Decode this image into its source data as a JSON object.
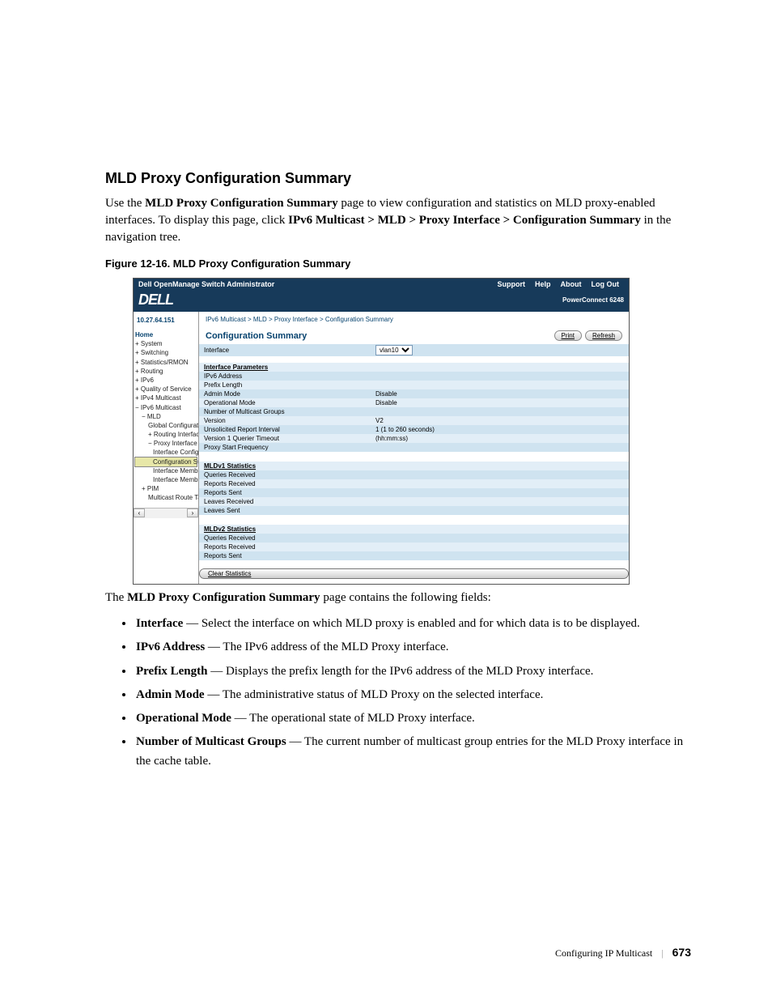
{
  "section_heading": "MLD Proxy Configuration Summary",
  "intro": {
    "pre": "Use the ",
    "bold1": "MLD Proxy Configuration Summary",
    "mid": " page to view configuration and statistics on MLD proxy-enabled interfaces. To display this page, click ",
    "bold2": "IPv6 Multicast > MLD > Proxy Interface > Configuration Summary",
    "post": " in the navigation tree."
  },
  "figure_caption": "Figure 12-16.    MLD Proxy Configuration Summary",
  "app": {
    "title": "Dell OpenManage Switch Administrator",
    "links": [
      "Support",
      "Help",
      "About",
      "Log Out"
    ],
    "logo": "DELL",
    "product": "PowerConnect 6248",
    "ip": "10.27.64.151",
    "bc": "IPv6 Multicast > MLD > Proxy Interface > Configuration Summary",
    "page_title": "Configuration Summary",
    "buttons": {
      "print": "Print",
      "refresh": "Refresh",
      "clear": "Clear Statistics"
    },
    "interface": {
      "label": "Interface",
      "value": "vlan10"
    },
    "groups": {
      "params": "Interface Parameters",
      "mld1": "MLDv1 Statistics",
      "mld2": "MLDv2 Statistics"
    },
    "rows": {
      "ipv6": "IPv6 Address",
      "prefix": "Prefix Length",
      "admin": "Admin Mode",
      "admin_v": "Disable",
      "op": "Operational Mode",
      "op_v": "Disable",
      "num": "Number of Multicast Groups",
      "ver": "Version",
      "ver_v": "V2",
      "uri": "Unsolicited Report Interval",
      "uri_v": "1  (1 to 260 seconds)",
      "v1q": "Version 1 Querier Timeout",
      "v1q_v": "(hh:mm:ss)",
      "psf": "Proxy Start Frequency",
      "qr": "Queries Received",
      "rr": "Reports Received",
      "rs": "Reports Sent",
      "lr": "Leaves Received",
      "ls": "Leaves Sent"
    },
    "nav": [
      {
        "t": "Home",
        "cls": "home"
      },
      {
        "t": "System",
        "pre": "+ "
      },
      {
        "t": "Switching",
        "pre": "+ "
      },
      {
        "t": "Statistics/RMON",
        "pre": "+ "
      },
      {
        "t": "Routing",
        "pre": "+ "
      },
      {
        "t": "IPv6",
        "pre": "+ "
      },
      {
        "t": "Quality of Service",
        "pre": "+ "
      },
      {
        "t": "IPv4 Multicast",
        "pre": "+ "
      },
      {
        "t": "IPv6 Multicast",
        "pre": "− "
      },
      {
        "t": "MLD",
        "pre": "− ",
        "i": 1
      },
      {
        "t": "Global Configuratio",
        "i": 2
      },
      {
        "t": "Routing Interface",
        "pre": "+ ",
        "i": 2
      },
      {
        "t": "Proxy Interface",
        "pre": "− ",
        "i": 2
      },
      {
        "t": "Interface Configu",
        "i": 3
      },
      {
        "t": "Configuration Su",
        "i": 3,
        "sel": true
      },
      {
        "t": "Interface Membe",
        "i": 3
      },
      {
        "t": "Interface Membe",
        "i": 3
      },
      {
        "t": "PIM",
        "pre": "+ ",
        "i": 1
      },
      {
        "t": "Multicast Route Table",
        "i": 2
      }
    ]
  },
  "post": {
    "pre": "The ",
    "bold": "MLD Proxy Configuration Summary",
    "post": " page contains the following fields:"
  },
  "fields": [
    {
      "b": "Interface",
      "t": " — Select the interface on which MLD proxy is enabled and for which data is to be displayed."
    },
    {
      "b": "IPv6 Address",
      "t": " — The IPv6 address of the MLD Proxy interface."
    },
    {
      "b": "Prefix Length",
      "t": " — Displays the prefix length for the IPv6 address of the MLD Proxy interface."
    },
    {
      "b": "Admin Mode",
      "t": " — The administrative status of MLD Proxy on the selected interface."
    },
    {
      "b": "Operational Mode",
      "t": " — The operational state of MLD Proxy interface."
    },
    {
      "b": "Number of Multicast Groups",
      "t": " — The current number of multicast group entries for the MLD Proxy interface in the cache table."
    }
  ],
  "footer": {
    "section": "Configuring IP Multicast",
    "page": "673"
  }
}
